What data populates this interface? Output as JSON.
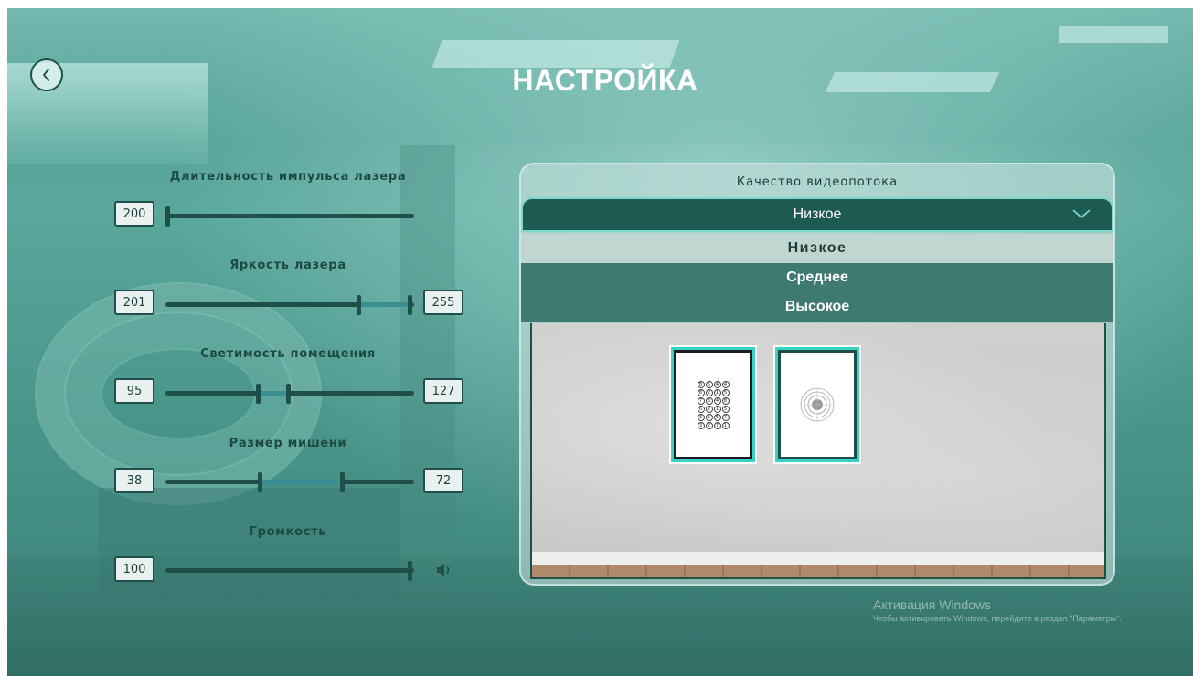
{
  "header": {
    "title": "НАСТРОЙКА"
  },
  "icons": {
    "back": "chevron-left-icon",
    "dropdown": "chevron-down-icon",
    "volume": "speaker-icon"
  },
  "sliders": {
    "laser_pulse": {
      "label": "Длительность импульса лазера",
      "min": 200
    },
    "laser_brightness": {
      "label": "Яркость лазера",
      "min": 201,
      "max": 255
    },
    "room_luminosity": {
      "label": "Светимость помещения",
      "min": 95,
      "max": 127
    },
    "target_size": {
      "label": "Размер мишени",
      "min": 38,
      "max": 72
    },
    "volume": {
      "label": "Громкость",
      "value": 100
    }
  },
  "video": {
    "label": "Качество видеопотока",
    "selected": "Низкое",
    "options": [
      "Низкое",
      "Среднее",
      "Высокое"
    ]
  },
  "preview": {
    "chart_numbers": [
      "8",
      "5",
      "4",
      "4",
      "8",
      "2",
      "1",
      "5",
      "7",
      "3",
      "4",
      "8",
      "6",
      "2",
      "1",
      "5",
      "3",
      "5",
      "6",
      "7",
      "3",
      "2",
      "7",
      "1"
    ]
  },
  "watermark": {
    "title": "Активация Windows",
    "subtitle": "Чтобы активировать Windows, перейдите в раздел \"Параметры\"."
  },
  "colors": {
    "accent": "#1d5a52",
    "teal_highlight": "#35d4c3",
    "track": "#1e4f49"
  }
}
